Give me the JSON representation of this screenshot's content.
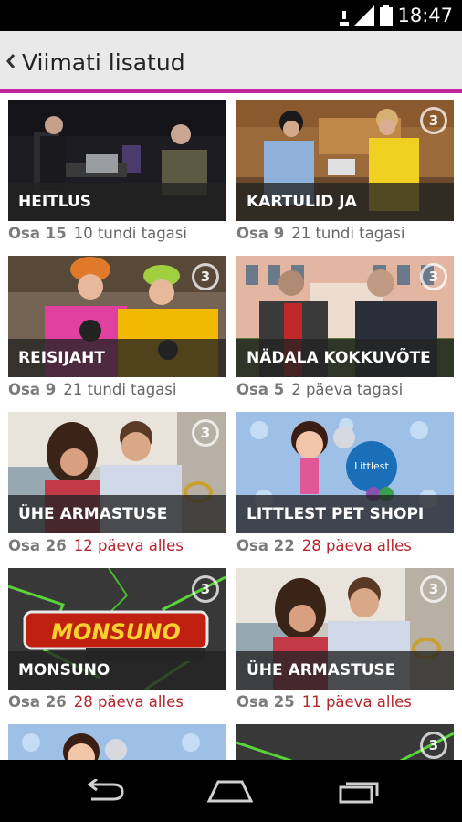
{
  "status_bar": {
    "time": "18:47",
    "icons": [
      "download-icon",
      "signal-icon",
      "battery-icon"
    ]
  },
  "action_bar": {
    "back_icon": "chevron-left-icon",
    "title": "Viimati lisatud"
  },
  "colors": {
    "accent": "#c6249a",
    "remaining_text": "#b5262e"
  },
  "items": [
    {
      "title": "HEITLUS",
      "episode": "Osa 15",
      "time_text": "10 tundi tagasi",
      "time_kind": "ago",
      "badge": ""
    },
    {
      "title": "KARTULID JA",
      "episode": "Osa 9",
      "time_text": "21 tundi tagasi",
      "time_kind": "ago",
      "badge": "3"
    },
    {
      "title": "REISIJAHT",
      "episode": "Osa 9",
      "time_text": "21 tundi tagasi",
      "time_kind": "ago",
      "badge": "3"
    },
    {
      "title": "NÄDALA KOKKUVÕTE",
      "episode": "Osa 5",
      "time_text": "2 päeva tagasi",
      "time_kind": "ago",
      "badge": "3"
    },
    {
      "title": "ÜHE ARMASTUSE",
      "episode": "Osa 26",
      "time_text": "12 päeva alles",
      "time_kind": "left",
      "badge": "3"
    },
    {
      "title": "LITTLEST PET SHOPI",
      "episode": "Osa 22",
      "time_text": "28 päeva alles",
      "time_kind": "left",
      "badge": ""
    },
    {
      "title": "MONSUNO",
      "episode": "Osa 26",
      "time_text": "28 päeva alles",
      "time_kind": "left",
      "badge": "3"
    },
    {
      "title": "ÜHE ARMASTUSE",
      "episode": "Osa 25",
      "time_text": "11 päeva alles",
      "time_kind": "left",
      "badge": "3"
    },
    {
      "title": "",
      "episode": "",
      "time_text": "",
      "time_kind": "left",
      "badge": ""
    },
    {
      "title": "",
      "episode": "",
      "time_text": "",
      "time_kind": "left",
      "badge": "3"
    }
  ],
  "nav_bar": {
    "icons": [
      "back-nav-icon",
      "home-icon",
      "recent-apps-icon"
    ]
  }
}
